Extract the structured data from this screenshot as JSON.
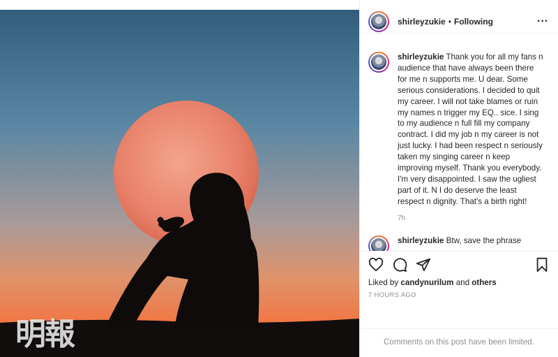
{
  "watermark": "明報",
  "post": {
    "username": "shirleyzukie",
    "separator": "•",
    "follow_status": "Following",
    "more_icon": "more-horizontal-icon"
  },
  "caption": {
    "username": "shirleyzukie",
    "text": "Thank you for all my fans n audience that have always been there for me n supports me. U dear. Some serious considerations. I decided to quit my career. I will not take blames or ruin my names n trigger my EQ.. sice. I sing to my audience n full fill my company contract. I did my job n my career is not just lucky. I had been respect n seriously taken my singing career n keep improving myself. Thank you everybody. I'm very disappointed. I saw the ugliest part of it. N I do deserve the least respect n dignity. That's a birth right!",
    "time": "7h"
  },
  "second_comment": {
    "username": "shirleyzukie",
    "text": "Btw, save the phrase"
  },
  "actions": {
    "like_icon": "heart-icon",
    "comment_icon": "comment-icon",
    "share_icon": "share-icon",
    "save_icon": "bookmark-icon"
  },
  "likes": {
    "prefix": "Liked by",
    "user": "candynurilum",
    "and": "and",
    "others": "others"
  },
  "timestamp": "7 HOURS AGO",
  "comments_limited": "Comments on this post have been limited."
}
